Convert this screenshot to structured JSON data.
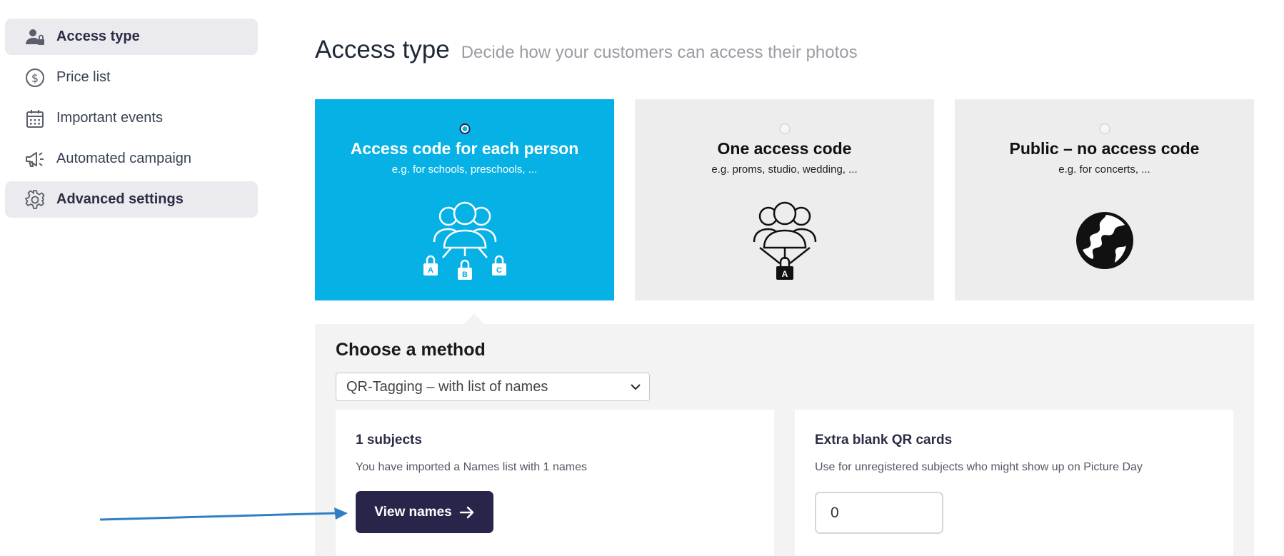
{
  "sidebar": {
    "items": [
      {
        "label": "Access type",
        "icon": "user-lock-icon",
        "active": true
      },
      {
        "label": "Price list",
        "icon": "dollar-circle-icon",
        "active": false
      },
      {
        "label": "Important events",
        "icon": "calendar-icon",
        "active": false
      },
      {
        "label": "Automated campaign",
        "icon": "megaphone-icon",
        "active": false
      },
      {
        "label": "Advanced settings",
        "icon": "gear-icon",
        "active": true
      }
    ]
  },
  "header": {
    "title": "Access type",
    "subtitle": "Decide how your customers can access their photos"
  },
  "access_options": [
    {
      "title": "Access code for each person",
      "description": "e.g. for schools, preschools, ...",
      "selected": true,
      "icon": "group-multiple-locks-icon"
    },
    {
      "title": "One access code",
      "description": "e.g. proms, studio, wedding, ...",
      "selected": false,
      "icon": "group-single-lock-icon"
    },
    {
      "title": "Public – no access code",
      "description": "e.g. for concerts, ...",
      "selected": false,
      "icon": "globe-icon"
    }
  ],
  "lock_letters": [
    "A",
    "B",
    "C"
  ],
  "method": {
    "title": "Choose a method",
    "selected": "QR-Tagging – with list of names"
  },
  "subjects": {
    "heading": "1 subjects",
    "text": "You have imported a Names list with 1 names",
    "button_label": "View names"
  },
  "qr_cards": {
    "heading": "Extra blank QR cards",
    "text": "Use for unregistered subjects who might show up on Picture Day",
    "value": "0"
  },
  "colors": {
    "selected_card": "#06b1e6",
    "button": "#27264a",
    "annotation_arrow": "#2f7fc4"
  }
}
